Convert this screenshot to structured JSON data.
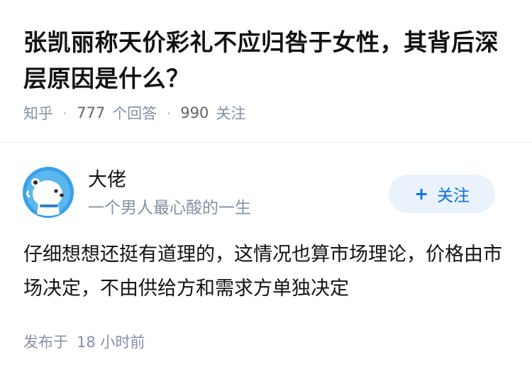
{
  "question": {
    "title": "张凯丽称天价彩礼不应归咎于女性，其背后深层原因是什么？",
    "source": "知乎",
    "answers_count": "777",
    "answers_label": "个回答",
    "followers_count": "990",
    "followers_label": "关注",
    "separator": "·"
  },
  "answer": {
    "author": {
      "name": "大佬",
      "bio": "一个男人最心酸的一生",
      "avatar_icon": "polar-bear-avatar-icon"
    },
    "follow_button": {
      "plus": "+",
      "label": "关注"
    },
    "content": "仔细想想还挺有道理的，这情况也算市场理论，价格由市场决定，不由供给方和需求方单独决定",
    "published_label": "发布于",
    "published_time": "18 小时前"
  },
  "colors": {
    "accent": "#056de8",
    "follow_bg": "#eaf2fb",
    "meta_text": "#8590a6",
    "title_text": "#121212",
    "avatar_bg": "#3aa0e6"
  }
}
